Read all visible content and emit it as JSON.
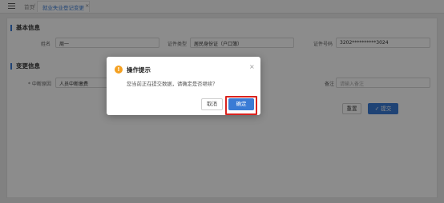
{
  "breadcrumb": {
    "home": "首页",
    "separator": "/",
    "current_tab": "就业失业登记变更",
    "tab_close": "×"
  },
  "basic_info": {
    "title": "基本信息",
    "name_label": "姓名",
    "name_value": "周一",
    "id_type_label": "证件类型",
    "id_type_value": "居民身份证（户口簿）",
    "id_number_label": "证件号码",
    "id_number_value": "3202**********3024"
  },
  "change_info": {
    "title": "变更信息",
    "reason_label": "* 中断原因",
    "reason_value": "人员中断缴费",
    "remark_label": "备注",
    "remark_placeholder": "请输入备注"
  },
  "actions": {
    "reset_label": "重置",
    "submit_label": "✓ 提交"
  },
  "dialog": {
    "icon_glyph": "!",
    "title": "操作提示",
    "message": "您当前正在提交数据，请确定是否继续？",
    "close_glyph": "×",
    "cancel_label": "取消",
    "confirm_label": "确定"
  },
  "colors": {
    "primary": "#3a7bd5",
    "warning": "#f4a020",
    "highlight": "#d9221e"
  }
}
